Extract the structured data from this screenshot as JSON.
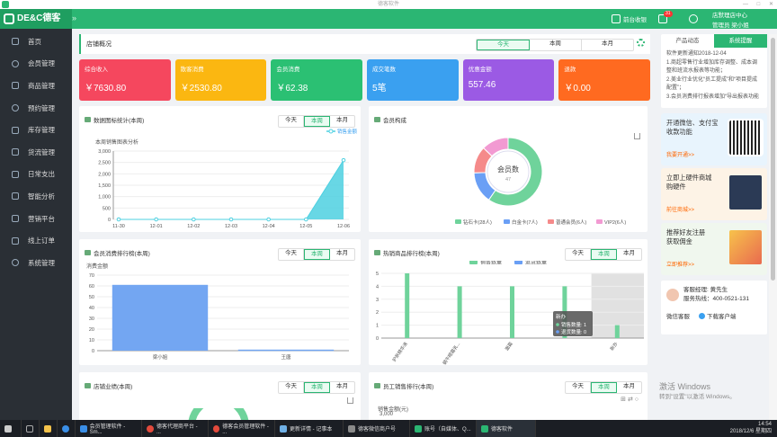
{
  "window": {
    "title": "德客软件",
    "controls": [
      "—",
      "□",
      "✕"
    ]
  },
  "topbar": {
    "brand": "DE&C德客",
    "collapse_icon": "double-chevron-right-icon",
    "front_cashier": "前台收银",
    "message_badge": "31",
    "user_line1": "店默理店中心",
    "user_line2": "管理员 梁小姐"
  },
  "sidebar": {
    "items": [
      {
        "label": "首页",
        "icon": "bar-chart-icon"
      },
      {
        "label": "会员管理",
        "icon": "user-icon"
      },
      {
        "label": "商品管理",
        "icon": "box-icon"
      },
      {
        "label": "预约管理",
        "icon": "clock-icon"
      },
      {
        "label": "库存管理",
        "icon": "layers-icon"
      },
      {
        "label": "货流管理",
        "icon": "truck-icon"
      },
      {
        "label": "日常支出",
        "icon": "wallet-icon"
      },
      {
        "label": "智能分析",
        "icon": "analysis-icon"
      },
      {
        "label": "营销平台",
        "icon": "gift-icon"
      },
      {
        "label": "线上订单",
        "icon": "order-icon"
      },
      {
        "label": "系统管理",
        "icon": "gear-icon"
      }
    ]
  },
  "overview": {
    "title": "店铺概况",
    "tabs": [
      "今天",
      "本周",
      "本月"
    ],
    "active": 0
  },
  "stats": [
    {
      "label": "综合收入",
      "value": "￥7630.80",
      "color": "#f5475e"
    },
    {
      "label": "散客消费",
      "value": "￥2530.80",
      "color": "#fbb711"
    },
    {
      "label": "会员消费",
      "value": "￥62.38",
      "color": "#2bc073"
    },
    {
      "label": "成交笔数",
      "value": "5笔",
      "color": "#3aa0f0"
    },
    {
      "label": "优惠金额",
      "value": "557.46",
      "color": "#9b5ae4"
    },
    {
      "label": "退款",
      "value": "￥0.00",
      "color": "#ff6a20"
    }
  ],
  "panels": {
    "data_chart": {
      "title": "数据图标统计(本周)",
      "tabs": [
        "今天",
        "本周",
        "本月"
      ],
      "active": 1
    },
    "member_comp": {
      "title": "会员构成"
    },
    "member_rank": {
      "title": "会员消费排行榜(本周)",
      "tabs": [
        "今天",
        "本周",
        "本月"
      ],
      "active": 1
    },
    "hot_goods": {
      "title": "热销商品排行榜(本周)",
      "tabs": [
        "今天",
        "本周",
        "本月"
      ],
      "active": 1
    },
    "store_perf": {
      "title": "店铺业绩(本周)",
      "tabs": [
        "今天",
        "本周",
        "本月"
      ],
      "active": 1
    },
    "staff_rank": {
      "title": "员工销售排行(本周)",
      "tabs": [
        "今天",
        "本周",
        "本月"
      ],
      "active": 1,
      "axis_label": "销售金额(元)",
      "top_tick": "3,000"
    }
  },
  "chart_data": [
    {
      "type": "area",
      "title": "本周销售图表分析",
      "legend": [
        "销售金额"
      ],
      "categories": [
        "11-30",
        "12-01",
        "12-02",
        "12-03",
        "12-04",
        "12-05",
        "12-06"
      ],
      "values": [
        0,
        0,
        0,
        0,
        0,
        0,
        2600
      ],
      "yticks": [
        "0",
        "500",
        "1,000",
        "1,500",
        "2,000",
        "2,500",
        "3,000"
      ],
      "ylim": [
        0,
        3000
      ],
      "color": "#4dd0e1"
    },
    {
      "type": "pie",
      "center_label": "会员数",
      "center_value": "47",
      "slices": [
        {
          "name": "钻石卡(28人)",
          "value": 28,
          "color": "#6fd39b"
        },
        {
          "name": "白金卡(7人)",
          "value": 7,
          "color": "#6a9ff5"
        },
        {
          "name": "普通会员(6人)",
          "value": 6,
          "color": "#f58a8a"
        },
        {
          "name": "VIP2(6人)",
          "value": 6,
          "color": "#f29ad2"
        }
      ]
    },
    {
      "type": "bar",
      "ylabel": "消费金额",
      "categories": [
        "梁小姐",
        "王唐"
      ],
      "values": [
        61,
        1
      ],
      "yticks": [
        "0",
        "10",
        "20",
        "30",
        "40",
        "50",
        "60",
        "70"
      ],
      "ylim": [
        0,
        70
      ],
      "color": "#73a6f2"
    },
    {
      "type": "bar",
      "series": [
        {
          "name": "销售数量",
          "values": [
            5,
            4,
            4,
            4,
            1
          ],
          "color": "#6fd39b"
        },
        {
          "name": "退货数量",
          "values": [
            0,
            0,
            0,
            0,
            0
          ],
          "color": "#6a9ff5"
        }
      ],
      "categories": [
        "护肤精华液",
        "蜗牛眼霜乳...",
        "面霜",
        "",
        "新办"
      ],
      "yticks": [
        "0",
        "1",
        "2",
        "3",
        "4",
        "5"
      ],
      "ylim": [
        0,
        5
      ],
      "tooltip": {
        "title": "新办",
        "lines": [
          "销售数量: 1",
          "退货数量: 0"
        ]
      }
    }
  ],
  "right": {
    "tabs": [
      "产品动态",
      "系统提醒"
    ],
    "active": 1,
    "news_title": "软件更新通知2018-12-04",
    "news_lines": [
      "1.商超零售行业增加库存调整、成本调整和班流水报表等功能；",
      "2.美业行业优化“员工提成”和“项目提成配置”；",
      "3.会员消费排行报表增加“导出报表功能"
    ],
    "promos": [
      {
        "title1": "开通微信、支付宝",
        "title2": "收款功能",
        "link": "我要开通>>",
        "bg": "#e8f4fd"
      },
      {
        "title1": "立即上硬件商城",
        "title2": "购硬件",
        "link": "前往商城>>",
        "bg": "#fdf3e6"
      },
      {
        "title1": "推荐好友注册",
        "title2": "获取佣金",
        "link": "立即推荐>>",
        "bg": "#f0f7ee"
      }
    ],
    "contact": {
      "manager": "客服经理: 黄先生",
      "phone": "服务热线：400-0521-131",
      "service": "微信客服",
      "download": "下载客户端"
    }
  },
  "watermark": {
    "line1": "激活 Windows",
    "line2": "转到\"设置\"以激活 Windows。"
  },
  "taskbar": {
    "apps": [
      "会员管理软件 - Sm...",
      "德客代理商平台 - ...",
      "德客会员管理软件 - ...",
      "更新详情 - 记事本",
      "德客微信商户号",
      "账号（自媒体、Q...",
      "德客软件"
    ],
    "time": "14:54",
    "date": "2018/12/6 星期四"
  }
}
